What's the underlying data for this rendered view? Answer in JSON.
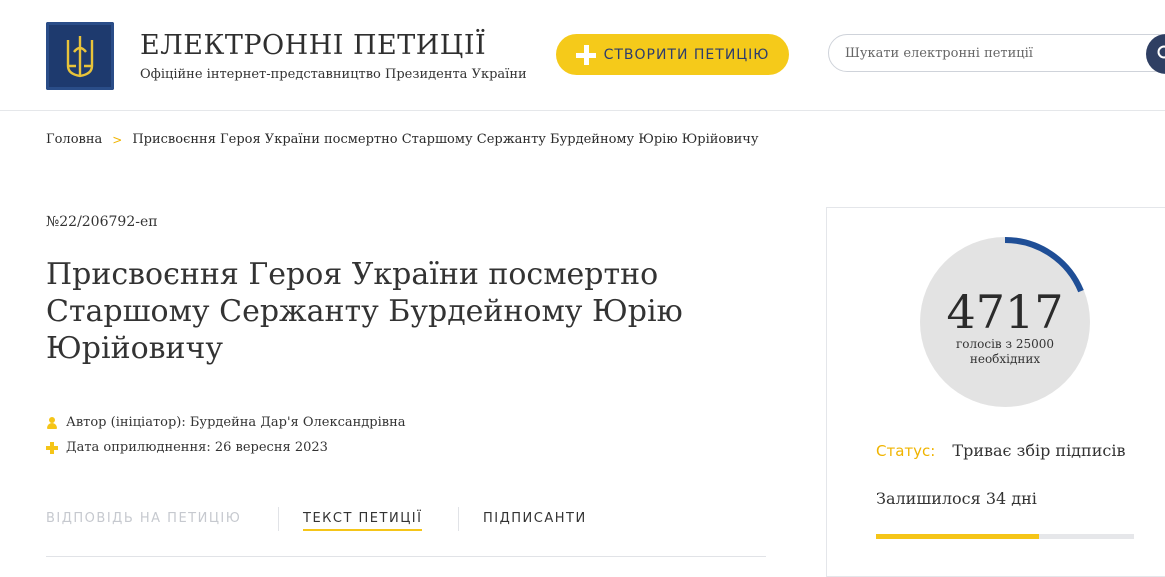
{
  "header": {
    "site_title": "ЕЛЕКТРОННІ ПЕТИЦІЇ",
    "site_subtitle": "Офіційне інтернет-представництво Президента України",
    "create_button": "СТВОРИТИ ПЕТИЦІЮ",
    "search_placeholder": "Шукати електронні петиції"
  },
  "breadcrumb": {
    "home": "Головна",
    "separator": ">",
    "current": "Присвоєння Героя України посмертно Старшому Сержанту Бурдейному Юрію Юрійовичу"
  },
  "petition": {
    "number": "№22/206792-еп",
    "title": "Присвоєння Героя України посмертно Старшому Сержанту Бурдейному Юрію Юрійовичу",
    "author": "Автор (ініціатор): Бурдейна Дар'я Олександрівна",
    "date": "Дата оприлюднення: 26 вересня 2023"
  },
  "tabs": {
    "answer": "ВІДПОВІДЬ НА ПЕТИЦІЮ",
    "text": "ТЕКСТ ПЕТИЦІЇ",
    "signers": "ПІДПИСАНТИ",
    "active": "text"
  },
  "votes": {
    "count": "4717",
    "label": "голосів з 25000 необхідних",
    "current": 4717,
    "required": 25000
  },
  "status": {
    "label": "Статус:",
    "value": "Триває збір підписів",
    "remaining": "Залишилося 34 дні",
    "time_progress": 0.63
  },
  "colors": {
    "accent_yellow": "#f5c518",
    "gauge_blue": "#1f4e96",
    "brand_navy": "#1e3a6e"
  }
}
